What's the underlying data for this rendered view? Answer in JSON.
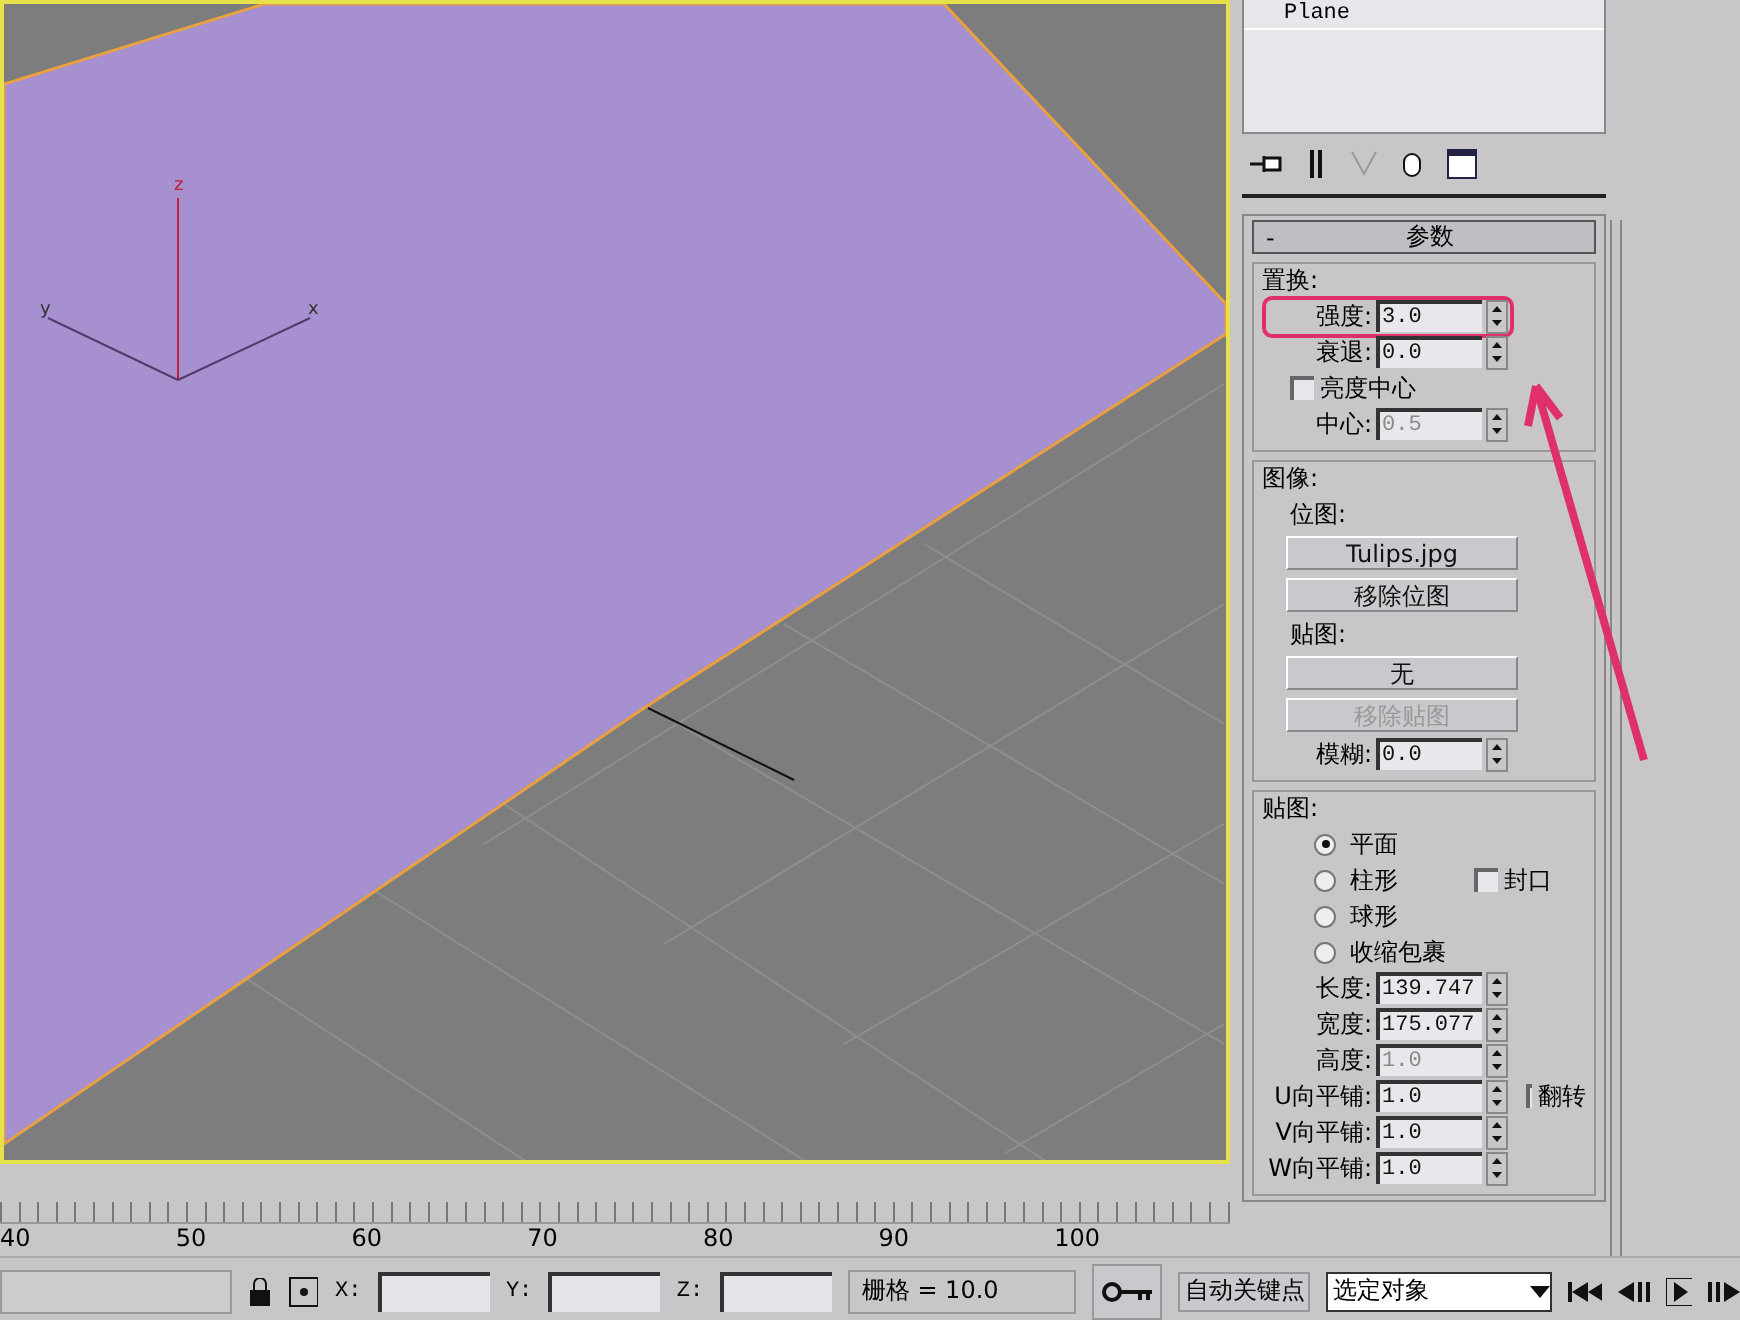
{
  "viewport": {
    "axis_labels": [
      "z",
      "y",
      "x"
    ]
  },
  "modifier_stack": {
    "items": [
      {
        "label": "Plane",
        "selected": false
      }
    ]
  },
  "rollout": {
    "collapse": "-",
    "title": "参数",
    "groups": [
      {
        "title": "置换:",
        "rows": [
          {
            "kind": "spinner",
            "label": "强度:",
            "value": "3.0",
            "disabled": false,
            "highlight": true
          },
          {
            "kind": "spinner",
            "label": "衰退:",
            "value": "0.0",
            "disabled": false
          },
          {
            "kind": "checkbox",
            "label": "亮度中心",
            "checked": false
          },
          {
            "kind": "spinner",
            "label": "中心:",
            "value": "0.5",
            "disabled": true
          }
        ]
      },
      {
        "title": "图像:",
        "rows": [
          {
            "kind": "label",
            "label": "位图:"
          },
          {
            "kind": "button",
            "label": "Tulips.jpg",
            "disabled": false
          },
          {
            "kind": "button",
            "label": "移除位图",
            "disabled": false
          },
          {
            "kind": "label",
            "label": "贴图:"
          },
          {
            "kind": "button",
            "label": "无",
            "disabled": false
          },
          {
            "kind": "button",
            "label": "移除贴图",
            "disabled": true
          },
          {
            "kind": "spinner",
            "label": "模糊:",
            "value": "0.0",
            "disabled": false
          }
        ]
      },
      {
        "title": "贴图:",
        "rows": [
          {
            "kind": "radio",
            "label": "平面",
            "selected": true
          },
          {
            "kind": "radio",
            "label": "柱形",
            "selected": false,
            "side_checkbox": {
              "label": "封口",
              "checked": false
            }
          },
          {
            "kind": "radio",
            "label": "球形",
            "selected": false
          },
          {
            "kind": "radio",
            "label": "收缩包裹",
            "selected": false
          },
          {
            "kind": "spinner",
            "label": "长度:",
            "value": "139.747",
            "disabled": false
          },
          {
            "kind": "spinner",
            "label": "宽度:",
            "value": "175.077",
            "disabled": false
          },
          {
            "kind": "spinner",
            "label": "高度:",
            "value": "1.0",
            "disabled": true
          },
          {
            "kind": "spinner",
            "label": "U向平铺:",
            "value": "1.0",
            "disabled": false,
            "side_checkbox": {
              "label": "翻转",
              "checked": false
            }
          },
          {
            "kind": "spinner",
            "label": "V向平铺:",
            "value": "1.0",
            "disabled": false
          },
          {
            "kind": "spinner",
            "label": "W向平铺:",
            "value": "1.0",
            "disabled": false
          }
        ]
      }
    ]
  },
  "timeline": {
    "ticks": [
      "40",
      "50",
      "60",
      "70",
      "80",
      "90",
      "100"
    ]
  },
  "status_bar": {
    "coords": [
      {
        "label": "X:"
      },
      {
        "label": "Y:"
      },
      {
        "label": "Z:"
      }
    ],
    "grid": "栅格 = 10.0",
    "auto_key": "自动关键点",
    "key_filter": "选定对象"
  }
}
